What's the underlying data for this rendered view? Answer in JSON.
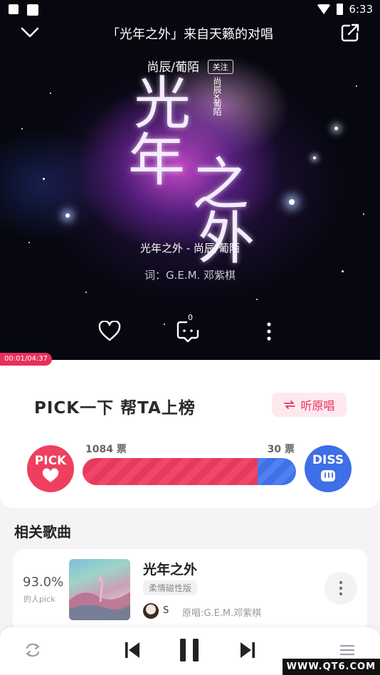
{
  "status_bar": {
    "time": "6:33"
  },
  "header": {
    "title": "「光年之外」来自天籁的对唱"
  },
  "artwork": {
    "chars": [
      "光",
      "年",
      "之",
      "外"
    ],
    "vertical_text": "尚辰x葡陌",
    "artists": "尚辰/葡陌",
    "follow_label": "关注",
    "song_line": "光年之外 - 尚辰/葡陌",
    "lyricist_line": "词：G.E.M. 邓紫棋"
  },
  "actions": {
    "comment_count": "0"
  },
  "progress": {
    "time": "00:01/04:37"
  },
  "pick": {
    "title": "PICK一下  帮TA上榜",
    "listen_label": "听原唱",
    "pick_badge": "PICK",
    "diss_badge": "DISS",
    "pick_votes": "1084 票",
    "diss_votes": "30 票",
    "pick_fraction": 0.82
  },
  "related": {
    "heading": "相关歌曲",
    "items": [
      {
        "percent": "93.0%",
        "percent_sub": "的人pick",
        "name": "光年之外",
        "tag": "柔情磁性版",
        "singer": "S",
        "original": "原唱:G.E.M.邓紫棋"
      }
    ]
  },
  "watermark": "WWW.QT6.COM",
  "colors": {
    "accent": "#e8305a",
    "diss": "#3e6fe6"
  }
}
